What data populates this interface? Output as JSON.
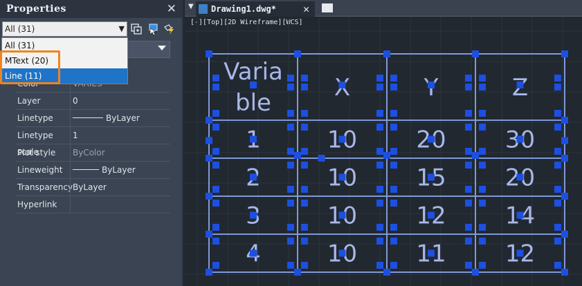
{
  "palette": {
    "title": "Properties",
    "close_icon": "close-icon",
    "selector_value": "All (31)",
    "tool_icons": [
      "toggle-pickadd-icon",
      "select-objects-icon",
      "quick-select-icon"
    ],
    "dropdown_options": [
      {
        "label": "All (31)",
        "selected": false
      },
      {
        "label": "MText (20)",
        "selected": false
      },
      {
        "label": "Line (11)",
        "selected": true
      }
    ],
    "rows": [
      {
        "name": "Color",
        "value": "VARIES",
        "style": "dim"
      },
      {
        "name": "Layer",
        "value": "0",
        "style": "normal"
      },
      {
        "name": "Linetype",
        "value": "ByLayer",
        "style": "line"
      },
      {
        "name": "Linetype scale",
        "value": "1",
        "style": "normal"
      },
      {
        "name": "Plot style",
        "value": "ByColor",
        "style": "dim"
      },
      {
        "name": "Lineweight",
        "value": "ByLayer",
        "style": "line"
      },
      {
        "name": "Transparency",
        "value": "ByLayer",
        "style": "normal"
      },
      {
        "name": "Hyperlink",
        "value": "",
        "style": "normal"
      }
    ]
  },
  "tabs": {
    "menu_icon": "tab-menu-icon",
    "active": "Drawing1.dwg*",
    "new_tab_icon": "new-tab-icon"
  },
  "viewport_label": "[-][Top][2D Wireframe][WCS]",
  "table": {
    "header": [
      "Varia\nble",
      "X",
      "Y",
      "Z"
    ],
    "rows": [
      [
        "1",
        "10",
        "20",
        "30"
      ],
      [
        "2",
        "10",
        "15",
        "20"
      ],
      [
        "3",
        "10",
        "12",
        "14"
      ],
      [
        "4",
        "10",
        "11",
        "12"
      ]
    ]
  },
  "colors": {
    "grip": "#1d4fe0",
    "table_line": "#7f9ad8",
    "table_text": "#a9b7e8",
    "highlight": "#f0841c",
    "dropdown_selected": "#1f74c8"
  }
}
